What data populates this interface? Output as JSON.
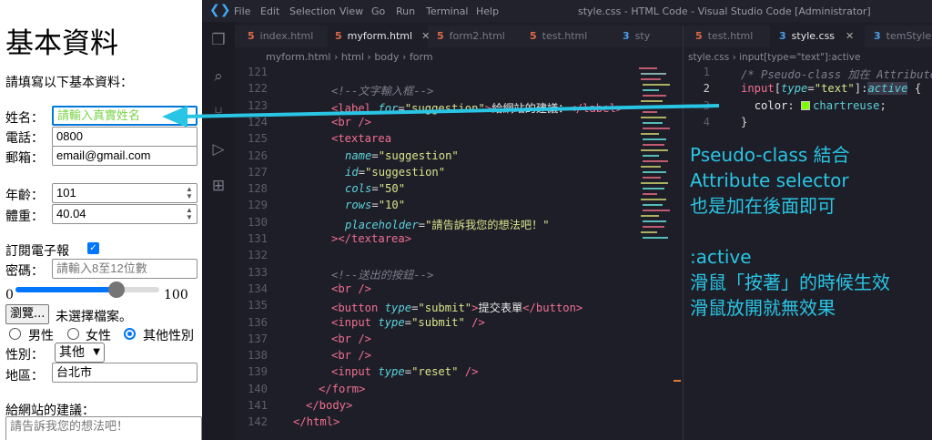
{
  "form": {
    "heading": "基本資料",
    "intro": "請填寫以下基本資料：",
    "name_label": "姓名：",
    "name_placeholder": "請輸入真實姓名",
    "phone_label": "電話：",
    "phone_value": "0800",
    "email_label": "郵箱：",
    "email_value": "email@gmail.com",
    "age_label": "年齡：",
    "age_value": "101",
    "weight_label": "體重：",
    "weight_value": "40.04",
    "subscribe_label": "訂閱電子報",
    "subscribe_checked": true,
    "password_label": "密碼：",
    "password_placeholder": "請輸入8至12位數",
    "range_min": "0",
    "range_max": "100",
    "range_value": 0.7,
    "browse_label": "瀏覽...",
    "file_status": "未選擇檔案。",
    "gender_options": [
      "男性",
      "女性",
      "其他性別"
    ],
    "gender_selected": "其他性別",
    "sex_label": "性別：",
    "sex_value": "其他",
    "region_label": "地區：",
    "region_value": "台北市",
    "suggestion_label": "給網站的建議：",
    "suggestion_placeholder": "請告訴我您的想法吧！"
  },
  "vscode": {
    "window_title": "style.css - HTML Code - Visual Studio Code [Administrator]",
    "menu": [
      "File",
      "Edit",
      "Selection",
      "View",
      "Go",
      "Run",
      "Terminal",
      "Help"
    ],
    "editor1": {
      "tabs": [
        {
          "label": "index.html",
          "type": "html",
          "active": false
        },
        {
          "label": "myform.html",
          "type": "html",
          "active": true
        },
        {
          "label": "form2.html",
          "type": "html",
          "active": false
        },
        {
          "label": "test.html",
          "type": "html",
          "active": false
        },
        {
          "label": "sty",
          "type": "css",
          "active": false
        }
      ],
      "breadcrumb": [
        "myform.html",
        "html",
        "body",
        "form"
      ],
      "line_numbers": [
        "121",
        "122",
        "123",
        "124",
        "125",
        "126",
        "127",
        "128",
        "129",
        "130",
        "131",
        "132",
        "133",
        "134",
        "135",
        "136",
        "137",
        "138",
        "139",
        "140",
        "141",
        "142"
      ]
    },
    "editor2": {
      "tabs": [
        {
          "label": "test.html",
          "type": "html",
          "active": false
        },
        {
          "label": "style.css",
          "type": "css",
          "active": true
        },
        {
          "label": "temStyle.c",
          "type": "css",
          "active": false
        }
      ],
      "breadcrumb": [
        "style.css",
        "input[type=\"text\"]:active"
      ],
      "line_numbers": [
        "1",
        "2",
        "3",
        "4"
      ]
    },
    "note": {
      "line1": "Pseudo-class 結合",
      "line2": "Attribute selector",
      "line3": "也是加在後面即可",
      "line4": ":active",
      "line5": "滑鼠「按著」的時候生效",
      "line6": "滑鼠放開就無效果"
    },
    "accent_color": "#29c5e4"
  }
}
